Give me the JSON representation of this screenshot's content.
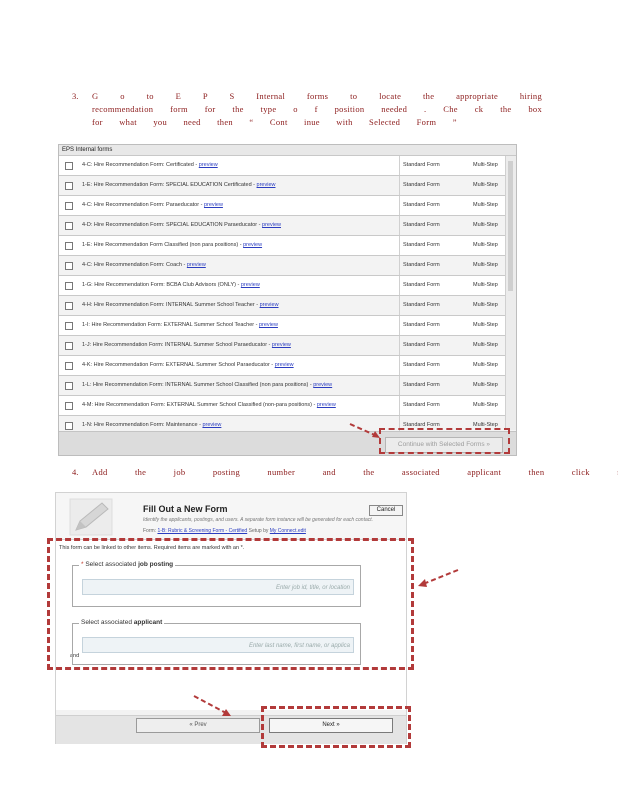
{
  "step3": {
    "number": "3.",
    "text": "G o to  E P S  Internal  forms  to locate  the  appropriate  hiring  recommendation  form  for  the type  o f position  needed . Che ck  the  box  for  what  you  need  then  “ Cont  inue  with  Selected Form ”"
  },
  "forms_panel": {
    "header": "EPS Internal forms",
    "preview_label": "preview",
    "rows": [
      {
        "name": "4-C: Hire Recommendation Form: Certificated -",
        "form_type": "Standard Form",
        "steps": "Multi-Step"
      },
      {
        "name": "1-E: Hire Recommendation Form: SPECIAL EDUCATION Certificated -",
        "form_type": "Standard Form",
        "steps": "Multi-Step"
      },
      {
        "name": "4-C: Hire Recommendation Form: Paraeducator -",
        "form_type": "Standard Form",
        "steps": "Multi-Step"
      },
      {
        "name": "4-D: Hire Recommendation Form: SPECIAL EDUCATION Paraeducator -",
        "form_type": "Standard Form",
        "steps": "Multi-Step"
      },
      {
        "name": "1-E: Hire Recommendation Form Classified (non para positions) -",
        "form_type": "Standard Form",
        "steps": "Multi-Step"
      },
      {
        "name": "4-C: Hire Recommendation Form: Coach -",
        "form_type": "Standard Form",
        "steps": "Multi-Step"
      },
      {
        "name": "1-G: Hire Recommendation Form: BCBA Club Advisors (ONLY) -",
        "form_type": "Standard Form",
        "steps": "Multi-Step"
      },
      {
        "name": "4-H: Hire Recommendation Form: INTERNAL Summer School Teacher -",
        "form_type": "Standard Form",
        "steps": "Multi-Step"
      },
      {
        "name": "1-I: Hire Recommendation Form: EXTERNAL Summer School Teacher -",
        "form_type": "Standard Form",
        "steps": "Multi-Step"
      },
      {
        "name": "1-J: Hire Recommendation Form: INTERNAL Summer School Paraeducator -",
        "form_type": "Standard Form",
        "steps": "Multi-Step"
      },
      {
        "name": "4-K: Hire Recommendation Form: EXTERNAL Summer School Paraeducator -",
        "form_type": "Standard Form",
        "steps": "Multi-Step"
      },
      {
        "name": "1-L: Hire Recommendation Form: INTERNAL Summer School Classified (non para positions) -",
        "form_type": "Standard Form",
        "steps": "Multi-Step"
      },
      {
        "name": "4-M: Hire Recommendation Form: EXTERNAL Summer School Classified (non-para positions) -",
        "form_type": "Standard Form",
        "steps": "Multi-Step"
      },
      {
        "name": "1-N: Hire Recommendation Form: Maintenance -",
        "form_type": "Standard Form",
        "steps": "Multi-Step"
      }
    ],
    "continue_button": "Continue with Selected Forms »"
  },
  "step4": {
    "number": "4.",
    "text": "Add the job posting number and the associated applicant then click next"
  },
  "fill_panel": {
    "title": "Fill Out a New Form",
    "cancel": "Cancel",
    "subtitle": "Identify the applicants, postings, and users. A separate form instance will be generated for each contact.",
    "form_prefix": "Form:",
    "form_link": "1-B: Rubric & Screening Form - Certified",
    "form_suffix": "Setup by",
    "form_user": "My Connect.edit",
    "link_note": "This form can be linked to other items. Required items are marked with an *.",
    "job_required_mark": "*",
    "job_legend_prefix": "Select associated",
    "job_legend_bold": "job posting",
    "job_placeholder": "Enter job id, title, or location",
    "and_label": "and",
    "app_legend_prefix": "Select associated",
    "app_legend_bold": "applicant",
    "app_placeholder": "Enter last name, first name, or applica",
    "prev_button": "« Prev",
    "next_button": "Next »"
  },
  "colors": {
    "annotation": "#b23a3a",
    "step_text": "#8b1a1a",
    "link": "#2a3cc0"
  }
}
